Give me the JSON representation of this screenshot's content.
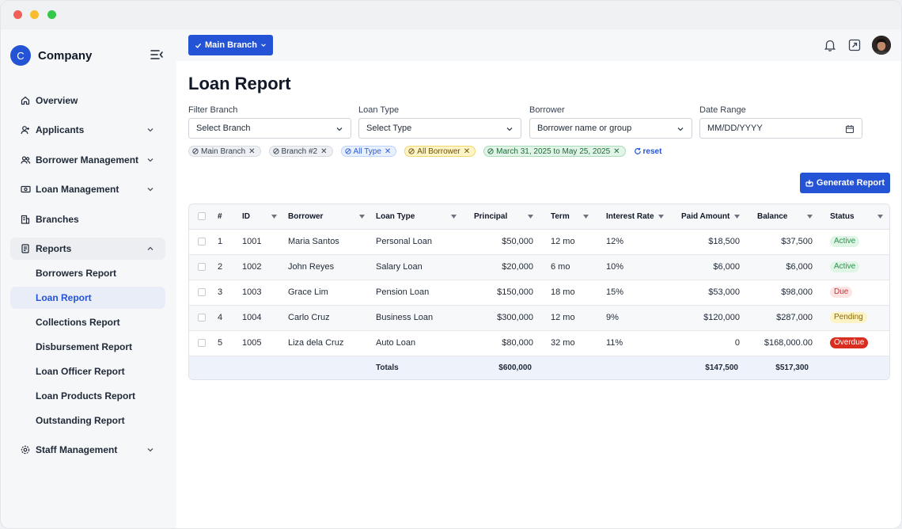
{
  "app": {
    "logo_letter": "C",
    "name": "Company"
  },
  "sidebar": {
    "items": [
      {
        "label": "Overview",
        "icon": "home-icon"
      },
      {
        "label": "Applicants",
        "icon": "user-icon"
      },
      {
        "label": "Borrower Management",
        "icon": "users-icon"
      },
      {
        "label": "Loan Management",
        "icon": "banknote-icon"
      },
      {
        "label": "Branches",
        "icon": "building-icon"
      },
      {
        "label": "Reports",
        "icon": "document-icon"
      },
      {
        "label": "Staff Management",
        "icon": "gear-icon"
      }
    ],
    "reports_sub": [
      "Borrowers Report",
      "Loan Report",
      "Collections Report",
      "Disbursement Report",
      "Loan Officer Report",
      "Loan Products Report",
      "Outstanding Report"
    ],
    "active_sub": "Loan Report"
  },
  "topbar": {
    "branch_button": "Main Branch"
  },
  "page": {
    "title": "Loan Report"
  },
  "filters": {
    "branch": {
      "label": "Filter Branch",
      "value": "Select Branch"
    },
    "loan_type": {
      "label": "Loan Type",
      "value": "Select Type"
    },
    "borrower": {
      "label": "Borrower",
      "value": "Borrower name or group"
    },
    "date_range": {
      "label": "Date Range",
      "value": "MM/DD/YYYY"
    }
  },
  "chips": [
    {
      "label": "Main Branch",
      "color": "gray"
    },
    {
      "label": "Branch #2",
      "color": "gray"
    },
    {
      "label": "All Type",
      "color": "blue"
    },
    {
      "label": "All Borrower",
      "color": "yellow"
    },
    {
      "label": "March 31, 2025 to May 25, 2025",
      "color": "green"
    }
  ],
  "reset_label": "reset",
  "generate_button": "Generate Report",
  "table": {
    "headers": {
      "num": "#",
      "id": "ID",
      "borrower": "Borrower",
      "loan_type": "Loan Type",
      "principal": "Principal",
      "term": "Term",
      "interest": "Interest Rate",
      "paid": "Paid Amount",
      "balance": "Balance",
      "status": "Status"
    },
    "rows": [
      {
        "num": "1",
        "id": "1001",
        "borrower": "Maria Santos",
        "loan_type": "Personal Loan",
        "principal": "$50,000",
        "term": "12 mo",
        "interest": "12%",
        "paid": "$18,500",
        "balance": "$37,500",
        "status": "Active"
      },
      {
        "num": "2",
        "id": "1002",
        "borrower": "John Reyes",
        "loan_type": "Salary Loan",
        "principal": "$20,000",
        "term": "6 mo",
        "interest": "10%",
        "paid": "$6,000",
        "balance": "$6,000",
        "status": "Active"
      },
      {
        "num": "3",
        "id": "1003",
        "borrower": "Grace Lim",
        "loan_type": "Pension Loan",
        "principal": "$150,000",
        "term": "18 mo",
        "interest": "15%",
        "paid": "$53,000",
        "balance": "$98,000",
        "status": "Due"
      },
      {
        "num": "4",
        "id": "1004",
        "borrower": "Carlo Cruz",
        "loan_type": "Business Loan",
        "principal": "$300,000",
        "term": "12 mo",
        "interest": "9%",
        "paid": "$120,000",
        "balance": "$287,000",
        "status": "Pending"
      },
      {
        "num": "5",
        "id": "1005",
        "borrower": "Liza dela Cruz",
        "loan_type": "Auto Loan",
        "principal": "$80,000",
        "term": "32 mo",
        "interest": "11%",
        "paid": "0",
        "balance": "$168,000.00",
        "status": "Overdue"
      }
    ],
    "totals": {
      "label": "Totals",
      "principal": "$600,000",
      "paid": "$147,500",
      "balance": "$517,300"
    }
  }
}
